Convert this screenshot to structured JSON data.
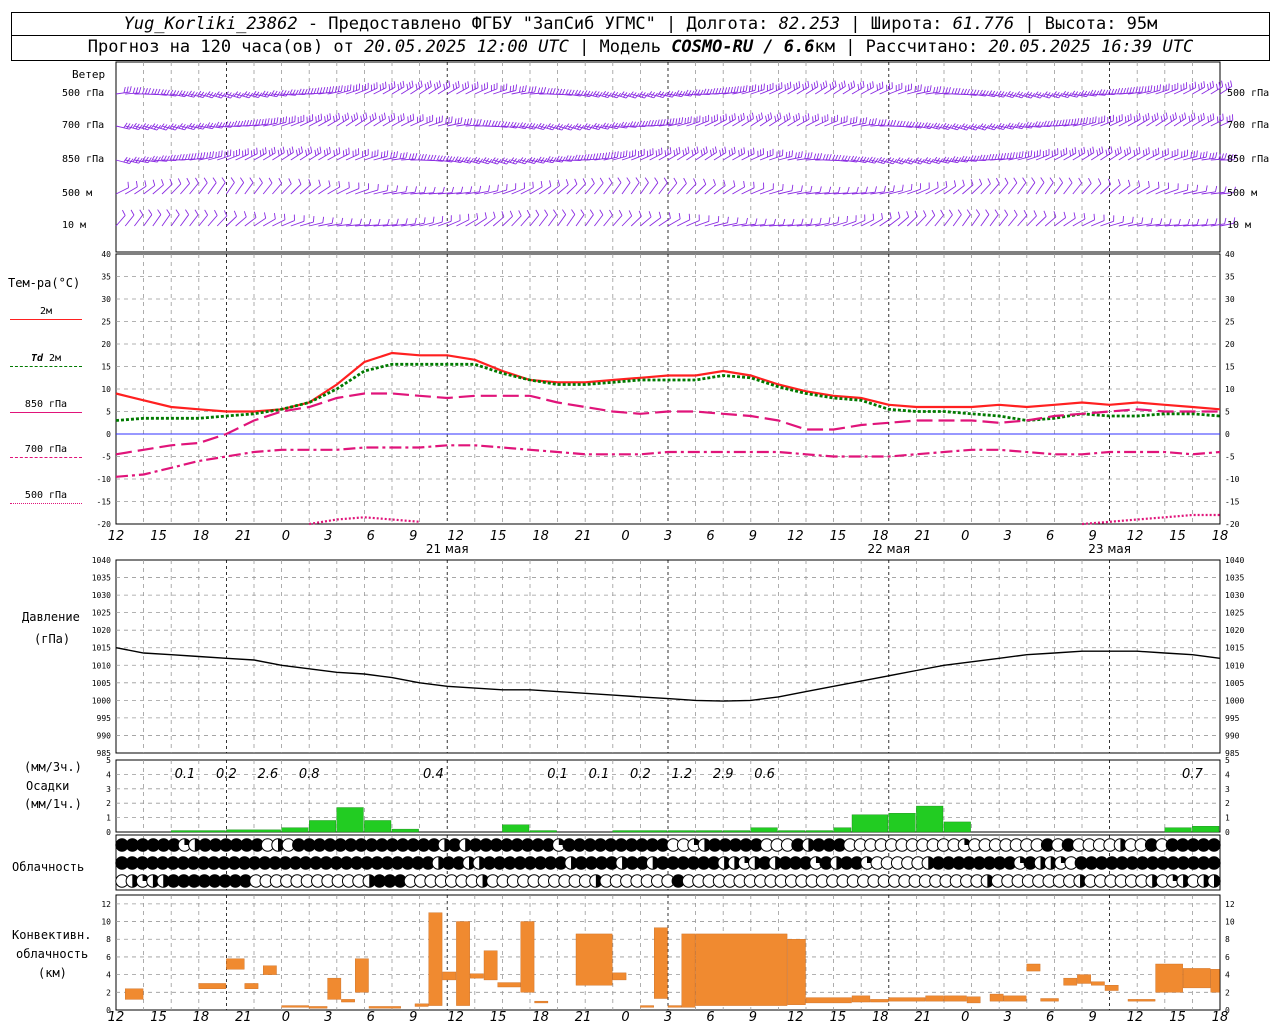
{
  "header": {
    "station": "Yug_Korliki_23862",
    "provided_by": " - Предоставлено ФГБУ \"ЗапСиб УГМС\" | Долгота: ",
    "longitude": "82.253",
    "lat_label": " | Широта: ",
    "latitude": "61.776",
    "alt_label": " | Высота: ",
    "altitude": "95м",
    "forecast_label": "Прогноз на 120 часа(ов) от ",
    "issued": "20.05.2025 12:00 UTC",
    "model_label": " | Модель ",
    "model": "COSMO-RU / 6.6",
    "km": "км",
    "calc_label": " | Рассчитано: ",
    "calculated": "20.05.2025 16:39 UTC"
  },
  "labels": {
    "wind": "Ветер",
    "wind_levels": [
      "500 гПа",
      "700 гПа",
      "850 гПа",
      "500 м",
      "10  м"
    ],
    "temp": "Тем-ра(°C)",
    "leg_2m": "2м",
    "leg_td_a": "Td",
    "leg_td_b": "2м",
    "leg_850": "850 гПа",
    "leg_700": "700 гПа",
    "leg_500": "500 гПа",
    "pressure_a": "Давление",
    "pressure_b": "(гПа)",
    "precip_a": "(мм/3ч.)",
    "precip_b": "Осадки",
    "precip_c": "(мм/1ч.)",
    "cloud": "Облачность",
    "conv_a": "Конвективн.",
    "conv_b": "облачность",
    "conv_c": "(км)"
  },
  "colors": {
    "t2m": "#ff2020",
    "td2m": "#007a00",
    "t850": "#e0147a",
    "t700": "#e0147a",
    "t500": "#e0147a",
    "wind": "#8a2be2",
    "precip": "#22cc22",
    "conv": "#f08a30",
    "zero": "#3030ff"
  },
  "chart_data": [
    {
      "type": "line",
      "name": "temperature",
      "x_hours": [
        0,
        3,
        6,
        9,
        12,
        15,
        18,
        21,
        24,
        27,
        30,
        33,
        36,
        39,
        42,
        45,
        48,
        51,
        54,
        57,
        60,
        63,
        66,
        69,
        72,
        75,
        78,
        81,
        84,
        87,
        90,
        93,
        96,
        99,
        102,
        105,
        108,
        111,
        114,
        117,
        120
      ],
      "ylim": [
        -20,
        40
      ],
      "yticks": [
        -20,
        -15,
        -10,
        -5,
        0,
        5,
        10,
        15,
        20,
        25,
        30,
        35,
        40
      ],
      "series": [
        {
          "name": "2м",
          "values": [
            9,
            7.5,
            6,
            5.5,
            5,
            5,
            5.5,
            7,
            11,
            16,
            18,
            17.5,
            17.5,
            16.5,
            14,
            12,
            11.5,
            11.5,
            12,
            12.5,
            13,
            13,
            14,
            13,
            11,
            9.5,
            8.5,
            8,
            6.5,
            6,
            6,
            6,
            6.5,
            6,
            6.5,
            7,
            6.5,
            7,
            6.5,
            6,
            5.5
          ]
        },
        {
          "name": "Td 2м",
          "values": [
            3,
            3.5,
            3.5,
            3.5,
            4,
            4.5,
            5.5,
            7,
            10,
            14,
            15.5,
            15.5,
            15.5,
            15.5,
            13.5,
            12,
            11,
            11,
            11.5,
            12,
            12,
            12,
            13,
            12.5,
            10.5,
            9,
            8,
            7.5,
            5.5,
            5,
            5,
            4.5,
            4,
            3,
            3.5,
            4.5,
            4,
            4,
            4.5,
            4.5,
            4
          ]
        },
        {
          "name": "850 гПа",
          "values": [
            -4.5,
            -3.5,
            -2.5,
            -2,
            0,
            3,
            5,
            6,
            8,
            9,
            9,
            8.5,
            8,
            8.5,
            8.5,
            8.5,
            7,
            6,
            5,
            4.5,
            5,
            5,
            4.5,
            4,
            3,
            1,
            1,
            2,
            2.5,
            3,
            3,
            3,
            2.5,
            3,
            4,
            4.5,
            5,
            5.5,
            5,
            5,
            5
          ]
        },
        {
          "name": "700 гПа",
          "values": [
            -9.5,
            -9,
            -7.5,
            -6,
            -5,
            -4,
            -3.5,
            -3.5,
            -3.5,
            -3,
            -3,
            -3,
            -2.5,
            -2.5,
            -3,
            -3.5,
            -4,
            -4.5,
            -4.5,
            -4.5,
            -4,
            -4,
            -4,
            -4,
            -4,
            -4.5,
            -5,
            -5,
            -5,
            -4.5,
            -4,
            -3.5,
            -3.5,
            -4,
            -4.5,
            -4.5,
            -4,
            -4,
            -4,
            -4.5,
            -4
          ]
        },
        {
          "name": "500 гПа",
          "values": [
            null,
            null,
            null,
            null,
            null,
            null,
            null,
            -20,
            -19,
            -18.5,
            -19,
            -19.5,
            null,
            null,
            null,
            null,
            null,
            null,
            null,
            null,
            null,
            null,
            null,
            null,
            null,
            null,
            null,
            null,
            null,
            null,
            null,
            null,
            null,
            null,
            null,
            -20,
            -19.5,
            -19,
            -18.5,
            -18,
            -18
          ]
        }
      ]
    },
    {
      "type": "line",
      "name": "pressure",
      "x_hours": [
        0,
        3,
        6,
        9,
        12,
        15,
        18,
        21,
        24,
        27,
        30,
        33,
        36,
        39,
        42,
        45,
        48,
        51,
        54,
        57,
        60,
        63,
        66,
        69,
        72,
        75,
        78,
        81,
        84,
        87,
        90,
        93,
        96,
        99,
        102,
        105,
        108,
        111,
        114,
        117,
        120
      ],
      "ylim": [
        985,
        1040
      ],
      "yticks": [
        985,
        990,
        995,
        1000,
        1005,
        1010,
        1015,
        1020,
        1025,
        1030,
        1035,
        1040
      ],
      "values": [
        1015,
        1013.5,
        1013,
        1012.5,
        1012,
        1011.5,
        1010,
        1009,
        1008,
        1007.5,
        1006.5,
        1005,
        1004,
        1003.5,
        1003,
        1003,
        1002.5,
        1002,
        1001.5,
        1001,
        1000.5,
        1000,
        999.8,
        1000,
        1001,
        1002.5,
        1004,
        1005.5,
        1007,
        1008.5,
        1010,
        1011,
        1012,
        1013,
        1013.5,
        1014,
        1014,
        1014,
        1013.5,
        1013,
        1012
      ]
    },
    {
      "type": "bar",
      "name": "precipitation",
      "ylim": [
        0,
        5
      ],
      "yticks": [
        0,
        1,
        2,
        3,
        4,
        5
      ],
      "hourly_start": 0,
      "hourly": [
        0,
        0,
        0,
        0,
        0,
        0,
        0,
        0,
        0,
        0,
        0,
        0,
        0,
        0,
        0.1,
        0.1,
        0.1,
        0.1,
        0.1,
        0.1,
        0.2,
        0.2,
        0.3,
        0.3,
        0.5,
        0.5,
        0.8,
        0.8,
        1.7,
        1.7,
        0.8,
        0.8,
        0.2,
        0.2,
        0,
        0,
        0,
        0,
        0,
        0,
        0,
        0,
        0,
        0,
        0,
        0,
        0,
        0,
        0,
        0,
        0,
        0,
        0,
        0,
        0,
        0,
        0,
        0,
        0,
        0,
        0,
        0,
        0,
        0,
        0,
        0,
        0,
        0,
        0,
        0,
        0,
        0,
        0,
        0,
        0,
        0,
        0,
        0,
        0,
        0,
        0,
        0,
        0,
        0,
        0,
        0,
        0,
        0,
        0,
        0,
        0,
        0,
        0,
        0,
        0,
        0,
        0,
        0,
        0,
        0,
        0,
        0,
        0,
        0,
        0,
        0,
        0,
        0,
        0,
        0,
        0,
        0,
        0,
        0,
        0,
        0,
        0,
        0,
        0,
        0
      ],
      "hourly_blocks": [
        {
          "start": 6,
          "end": 12,
          "value": 0.1
        },
        {
          "start": 12,
          "end": 18,
          "value": 0.15
        },
        {
          "start": 18,
          "end": 21,
          "value": 0.3
        },
        {
          "start": 21,
          "end": 24,
          "value": 0.8
        },
        {
          "start": 24,
          "end": 27,
          "value": 1.7
        },
        {
          "start": 27,
          "end": 30,
          "value": 0.8
        },
        {
          "start": 30,
          "end": 33,
          "value": 0.2
        },
        {
          "start": 42,
          "end": 45,
          "value": 0.5
        },
        {
          "start": 45,
          "end": 48,
          "value": 0.1
        },
        {
          "start": 54,
          "end": 60,
          "value": 0.1
        },
        {
          "start": 60,
          "end": 63,
          "value": 0.1
        },
        {
          "start": 63,
          "end": 66,
          "value": 0.1
        },
        {
          "start": 66,
          "end": 69,
          "value": 0.1
        },
        {
          "start": 69,
          "end": 72,
          "value": 0.3
        },
        {
          "start": 72,
          "end": 75,
          "value": 0.1
        },
        {
          "start": 75,
          "end": 78,
          "value": 0.1
        },
        {
          "start": 78,
          "end": 80,
          "value": 0.3
        },
        {
          "start": 80,
          "end": 84,
          "value": 1.2
        },
        {
          "start": 84,
          "end": 87,
          "value": 1.3
        },
        {
          "start": 87,
          "end": 90,
          "value": 1.8
        },
        {
          "start": 90,
          "end": 93,
          "value": 0.7
        },
        {
          "start": 114,
          "end": 117,
          "value": 0.3
        },
        {
          "start": 117,
          "end": 120,
          "value": 0.4
        }
      ],
      "labels_3h": [
        {
          "hour": 7.5,
          "text": "0.1"
        },
        {
          "hour": 12,
          "text": "0.2"
        },
        {
          "hour": 16.5,
          "text": "2.6"
        },
        {
          "hour": 21,
          "text": "0.8"
        },
        {
          "hour": 34.5,
          "text": "0.4"
        },
        {
          "hour": 48,
          "text": "0.1"
        },
        {
          "hour": 52.5,
          "text": "0.1"
        },
        {
          "hour": 57,
          "text": "0.2"
        },
        {
          "hour": 61.5,
          "text": "1.2"
        },
        {
          "hour": 66,
          "text": "2.9"
        },
        {
          "hour": 70.5,
          "text": "0.6"
        },
        {
          "hour": 117,
          "text": "0.7"
        }
      ]
    },
    {
      "type": "bar",
      "name": "convective cloud",
      "ylim": [
        0,
        13
      ],
      "yticks": [
        0,
        2,
        4,
        6,
        8,
        10,
        12
      ],
      "bars": [
        {
          "start": 1,
          "end": 3,
          "bottom": 1.2,
          "top": 2.4
        },
        {
          "start": 9,
          "end": 12,
          "bottom": 2.4,
          "top": 3.0
        },
        {
          "start": 12,
          "end": 14,
          "bottom": 4.6,
          "top": 5.8
        },
        {
          "start": 14,
          "end": 15.5,
          "bottom": 2.4,
          "top": 3.0
        },
        {
          "start": 16,
          "end": 17.5,
          "bottom": 4.0,
          "top": 5.0
        },
        {
          "start": 18,
          "end": 21,
          "bottom": 0.3,
          "top": 0.5
        },
        {
          "start": 21,
          "end": 23,
          "bottom": 0.2,
          "top": 0.4
        },
        {
          "start": 23,
          "end": 24.5,
          "bottom": 1.2,
          "top": 3.6
        },
        {
          "start": 24.5,
          "end": 26,
          "bottom": 0.9,
          "top": 1.2
        },
        {
          "start": 26,
          "end": 27.5,
          "bottom": 2.0,
          "top": 5.8
        },
        {
          "start": 27.5,
          "end": 31,
          "bottom": 0.2,
          "top": 0.4
        },
        {
          "start": 32.5,
          "end": 34,
          "bottom": 0.4,
          "top": 0.7
        },
        {
          "start": 34,
          "end": 35.5,
          "bottom": 0.5,
          "top": 11.0
        },
        {
          "start": 35.5,
          "end": 37,
          "bottom": 3.4,
          "top": 4.3
        },
        {
          "start": 37,
          "end": 38.5,
          "bottom": 0.5,
          "top": 10.0
        },
        {
          "start": 38.5,
          "end": 40,
          "bottom": 3.6,
          "top": 4.1
        },
        {
          "start": 40,
          "end": 41.5,
          "bottom": 3.4,
          "top": 6.7
        },
        {
          "start": 41.5,
          "end": 44,
          "bottom": 2.6,
          "top": 3.1
        },
        {
          "start": 44,
          "end": 45.5,
          "bottom": 2.0,
          "top": 10.0
        },
        {
          "start": 45.5,
          "end": 47,
          "bottom": 0.8,
          "top": 1.0
        },
        {
          "start": 50,
          "end": 54,
          "bottom": 2.8,
          "top": 8.6
        },
        {
          "start": 54,
          "end": 55.5,
          "bottom": 3.4,
          "top": 4.2
        },
        {
          "start": 57,
          "end": 58.5,
          "bottom": 0.3,
          "top": 0.5
        },
        {
          "start": 58.5,
          "end": 60,
          "bottom": 1.3,
          "top": 9.3
        },
        {
          "start": 60,
          "end": 61.5,
          "bottom": 0.3,
          "top": 0.5
        },
        {
          "start": 61.5,
          "end": 63,
          "bottom": 0.3,
          "top": 8.6
        },
        {
          "start": 63,
          "end": 73,
          "bottom": 0.5,
          "top": 8.6
        },
        {
          "start": 73,
          "end": 75,
          "bottom": 0.6,
          "top": 8.0
        },
        {
          "start": 75,
          "end": 80,
          "bottom": 0.8,
          "top": 1.4
        },
        {
          "start": 80,
          "end": 82,
          "bottom": 0.9,
          "top": 1.6
        },
        {
          "start": 82,
          "end": 84,
          "bottom": 0.9,
          "top": 1.2
        },
        {
          "start": 84,
          "end": 88,
          "bottom": 1.0,
          "top": 1.4
        },
        {
          "start": 88,
          "end": 90,
          "bottom": 1.0,
          "top": 1.6
        },
        {
          "start": 90,
          "end": 92.5,
          "bottom": 1.0,
          "top": 1.6
        },
        {
          "start": 92.5,
          "end": 94,
          "bottom": 0.8,
          "top": 1.5
        },
        {
          "start": 95,
          "end": 96.5,
          "bottom": 1.0,
          "top": 1.8
        },
        {
          "start": 96.5,
          "end": 99,
          "bottom": 1.0,
          "top": 1.6
        },
        {
          "start": 99,
          "end": 100.5,
          "bottom": 4.4,
          "top": 5.2
        },
        {
          "start": 100.5,
          "end": 102.5,
          "bottom": 1.0,
          "top": 1.3
        },
        {
          "start": 103,
          "end": 104.5,
          "bottom": 2.8,
          "top": 3.6
        },
        {
          "start": 104.5,
          "end": 106,
          "bottom": 3.0,
          "top": 4.0
        },
        {
          "start": 106,
          "end": 107.5,
          "bottom": 2.8,
          "top": 3.2
        },
        {
          "start": 107.5,
          "end": 109,
          "bottom": 2.2,
          "top": 2.8
        },
        {
          "start": 110,
          "end": 113,
          "bottom": 1.0,
          "top": 1.2
        },
        {
          "start": 113,
          "end": 116,
          "bottom": 2.0,
          "top": 5.2
        },
        {
          "start": 116,
          "end": 119,
          "bottom": 2.5,
          "top": 4.7
        },
        {
          "start": 119,
          "end": 120,
          "bottom": 2.0,
          "top": 4.6
        }
      ]
    }
  ],
  "time_axis": {
    "tick_labels": [
      "12",
      "15",
      "18",
      "21",
      "0",
      "3",
      "6",
      "9",
      "12",
      "15",
      "18",
      "21",
      "0",
      "3",
      "6",
      "9",
      "12",
      "15",
      "18",
      "21",
      "0",
      "3",
      "6",
      "9",
      "12",
      "15",
      "18"
    ],
    "day_labels": [
      "21 мая",
      "22 мая",
      "23 мая"
    ],
    "day_label_hours": [
      36,
      84,
      108
    ]
  },
  "cloud_rows": {
    "upper": "FFFFFFQHFFFFFFEHEFFFFFFFFFFFFFFHFHFFFFFFFFQFFFFFFFFFFEEQHFFFFFEEEFHFFFEEEEEEEEEEEQEEEEEEEFEFEEEEHEEFEFFFFF",
    "middle": "FFFFFFFFFFFFFFFFFFFFFFFFFFFFFFFHFFHHFFFFFFFFHFFFFHFFHFFFFFFHHQHFHFFFQFHFFQEEEEEHFFFFFFFFQFHHQEFFFFFFFFFFFFFF",
    "lower": "EHQHHFFFFFFFFEEEEEEEEEEEHFFFEEEEEEEHEEEEEEEEEEHEEEEEEEFEEEEEEEEEEEEEEEEEEEEEEEEEEEEEHEEEEEEEEHEEEEEEHEQHEHH"
  }
}
